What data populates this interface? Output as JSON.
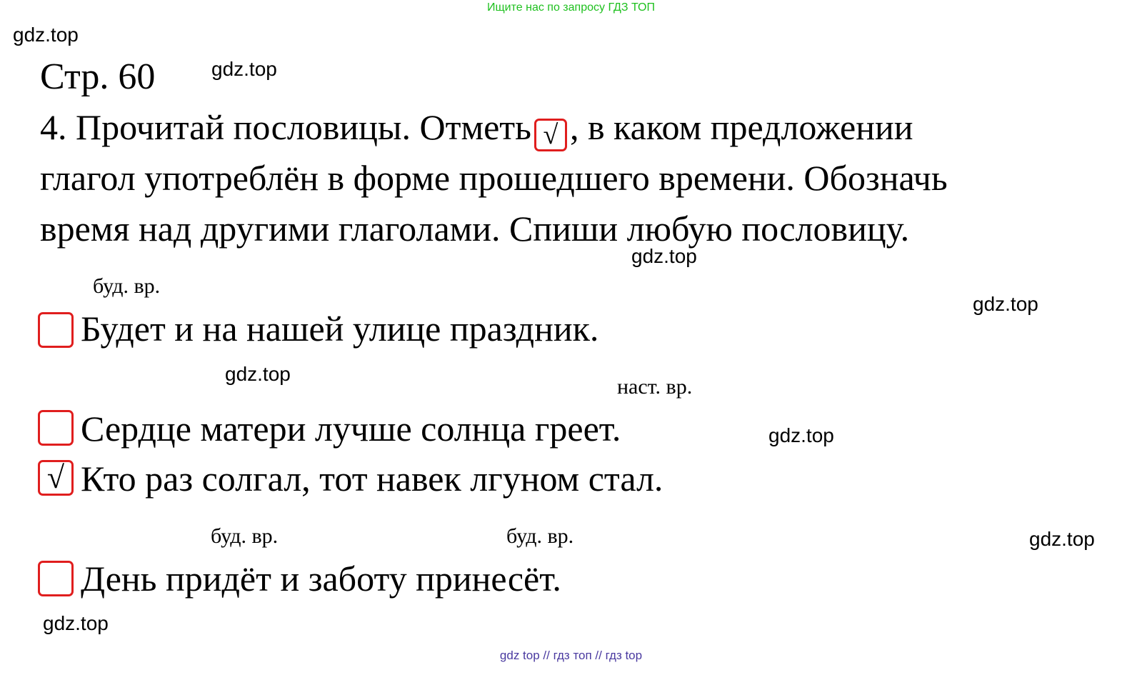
{
  "banner": "Ищите нас по запросу ГДЗ ТОП",
  "watermark": "gdz.top",
  "page_title": "Стр. 60",
  "task": {
    "line1_before": "4. Прочитай пословицы. Отметь",
    "check_mark": "√",
    "line1_after": ", в каком предложении",
    "line2": "глагол употреблён в форме прошедшего времени. Обозначь",
    "line3": "время над другими глаголами. Спиши любую пословицу."
  },
  "proverbs": [
    {
      "text": "Будет и на нашей улице праздник.",
      "checked": false,
      "annotation": "буд. вр."
    },
    {
      "text": "Сердце матери лучше солнца греет.",
      "checked": false,
      "annotation": "наст. вр."
    },
    {
      "text": "Кто раз солгал, тот навек лгуном стал.",
      "checked": true,
      "mark": "√"
    },
    {
      "text": "День придёт и заботу принесёт.",
      "checked": false,
      "annotations": [
        "буд. вр.",
        "буд. вр."
      ]
    }
  ],
  "footer": "gdz top  //  гдз топ  //  гдз top",
  "colors": {
    "checkbox_border": "#e01e1e",
    "banner": "#1ec01e",
    "footer": "#4a3aa0"
  }
}
